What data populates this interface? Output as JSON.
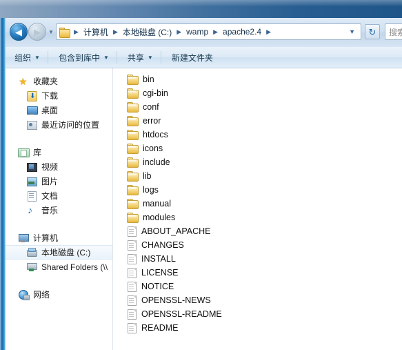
{
  "window": {
    "title": ""
  },
  "navbar": {
    "back_label": "◀",
    "forward_label": "▶",
    "history_caret": "▼",
    "folder_icon": "folder-icon",
    "breadcrumbs": [
      "计算机",
      "本地磁盘 (C:)",
      "wamp",
      "apache2.4"
    ],
    "separator": "▶",
    "dropdown_caret": "▼",
    "refresh_label": "↻",
    "search_placeholder": "搜索"
  },
  "toolbar": {
    "items": [
      {
        "label": "组织",
        "has_caret": true
      },
      {
        "label": "包含到库中",
        "has_caret": true
      },
      {
        "label": "共享",
        "has_caret": true
      },
      {
        "label": "新建文件夹",
        "has_caret": false
      }
    ],
    "caret": "▼"
  },
  "sidebar": {
    "groups": [
      {
        "header": {
          "label": "收藏夹",
          "icon": "star-icon"
        },
        "items": [
          {
            "label": "下载",
            "icon": "download-icon"
          },
          {
            "label": "桌面",
            "icon": "desktop-icon"
          },
          {
            "label": "最近访问的位置",
            "icon": "recent-places-icon"
          }
        ]
      },
      {
        "header": {
          "label": "库",
          "icon": "library-icon"
        },
        "items": [
          {
            "label": "视频",
            "icon": "video-icon"
          },
          {
            "label": "图片",
            "icon": "picture-icon"
          },
          {
            "label": "文档",
            "icon": "document-icon"
          },
          {
            "label": "音乐",
            "icon": "music-icon"
          }
        ]
      },
      {
        "header": {
          "label": "计算机",
          "icon": "computer-icon"
        },
        "items": [
          {
            "label": "本地磁盘 (C:)",
            "icon": "hard-disk-icon",
            "selected": true
          },
          {
            "label": "Shared Folders (\\\\",
            "icon": "shared-folder-icon",
            "selected": false
          }
        ]
      },
      {
        "header": {
          "label": "网络",
          "icon": "network-icon"
        },
        "items": []
      }
    ]
  },
  "file_list": {
    "items": [
      {
        "name": "bin",
        "type": "folder"
      },
      {
        "name": "cgi-bin",
        "type": "folder"
      },
      {
        "name": "conf",
        "type": "folder"
      },
      {
        "name": "error",
        "type": "folder"
      },
      {
        "name": "htdocs",
        "type": "folder"
      },
      {
        "name": "icons",
        "type": "folder"
      },
      {
        "name": "include",
        "type": "folder"
      },
      {
        "name": "lib",
        "type": "folder"
      },
      {
        "name": "logs",
        "type": "folder"
      },
      {
        "name": "manual",
        "type": "folder"
      },
      {
        "name": "modules",
        "type": "folder"
      },
      {
        "name": "ABOUT_APACHE",
        "type": "file"
      },
      {
        "name": "CHANGES",
        "type": "file"
      },
      {
        "name": "INSTALL",
        "type": "file"
      },
      {
        "name": "LICENSE",
        "type": "file"
      },
      {
        "name": "NOTICE",
        "type": "file"
      },
      {
        "name": "OPENSSL-NEWS",
        "type": "file"
      },
      {
        "name": "OPENSSL-README",
        "type": "file"
      },
      {
        "name": "README",
        "type": "file"
      }
    ]
  },
  "colors": {
    "title_bar_start": "#8fa7c0",
    "title_bar_end": "#1f5689",
    "frame_blue": "#1b6fb0",
    "toolbar_bg": "#dceaf6",
    "content_bg": "#ffffff",
    "folder_gold": "#efc95f",
    "selection": "#eaf3fb"
  }
}
